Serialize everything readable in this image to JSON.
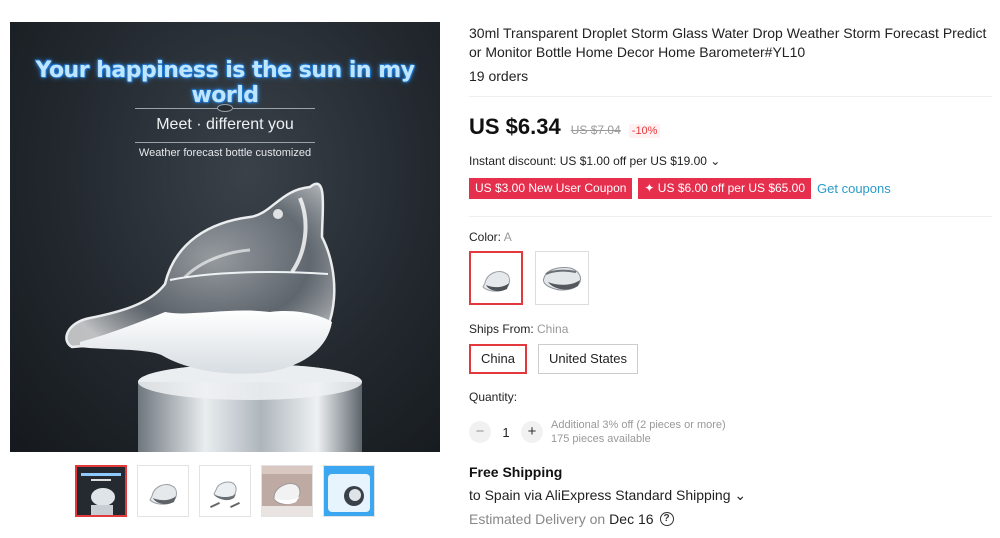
{
  "gallery": {
    "headline": "Your happiness is the sun in my world",
    "subtitle": "Meet · different you",
    "caption": "Weather forecast bottle customized",
    "thumbnails": [
      {
        "name": "thumb-1",
        "active": true
      },
      {
        "name": "thumb-2",
        "active": false
      },
      {
        "name": "thumb-3",
        "active": false
      },
      {
        "name": "thumb-4",
        "active": false
      },
      {
        "name": "thumb-5",
        "active": false
      }
    ]
  },
  "product": {
    "title": "30ml Transparent Droplet Storm Glass Water Drop Weather Storm Forecast Predictor Monitor Bottle Home Decor Home Barometer#YL10",
    "orders": "19 orders",
    "price": "US $6.34",
    "old_price": "US $7.04",
    "discount": "-10%",
    "instant_discount": "Instant discount: US $1.00 off per US $19.00 ⌄",
    "coupons": [
      "US $3.00 New User Coupon",
      "✦ US $6.00 off per US $65.00"
    ],
    "get_coupons": "Get coupons"
  },
  "color": {
    "label": "Color: ",
    "selected": "A"
  },
  "ships_from": {
    "label": "Ships From: ",
    "selected": "China",
    "options": [
      "China",
      "United States"
    ]
  },
  "quantity": {
    "label": "Quantity:",
    "minus": "−",
    "value": "1",
    "plus": "+",
    "note_line1": "Additional 3% off (2 pieces or more)",
    "note_line2": "175 pieces available"
  },
  "shipping": {
    "title": "Free Shipping",
    "to": "to Spain via AliExpress Standard Shipping ⌄",
    "delivery_prefix": "Estimated Delivery on",
    "delivery_date": "Dec 16",
    "help_icon": "?"
  },
  "colors": {
    "accent": "#e4393c",
    "coupon_bg": "#e62e4d",
    "link": "#2a9bc9"
  }
}
